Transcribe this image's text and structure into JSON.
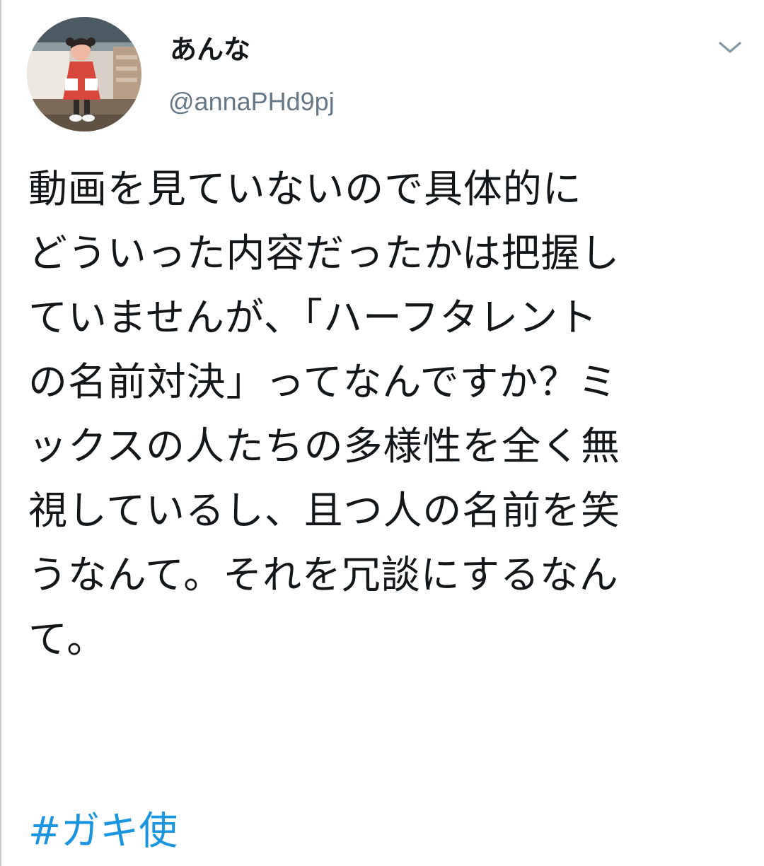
{
  "user": {
    "display_name": "あんな",
    "handle": "@annaPHd9pj",
    "avatar": "profile-photo-child-red-coat"
  },
  "menu": {
    "icon": "chevron-down-icon"
  },
  "tweet": {
    "lines": [
      "動画を見ていないので具体的に",
      "どういった内容だったかは把握し",
      "ていませんが、「ハーフタレント",
      "の名前対決」ってなんですか？ミ",
      "ックスの人たちの多様性を全く無",
      "視しているし、且つ人の名前を笑",
      "うなんて。それを冗談にするなん",
      "て。"
    ],
    "hashtag": "#ガキ使"
  },
  "colors": {
    "text": "#14171a",
    "secondary": "#657786",
    "link": "#1b95e0",
    "chevron": "#8899a6"
  }
}
